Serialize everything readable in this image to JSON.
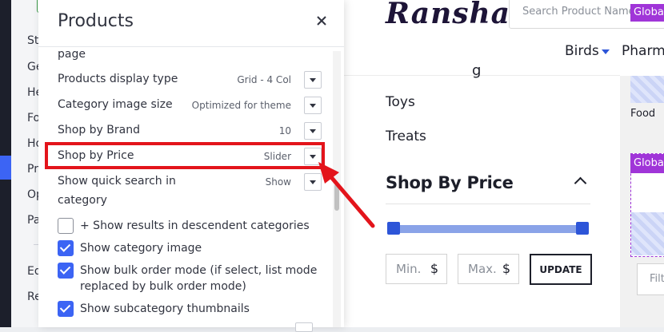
{
  "sidebar": {
    "items": [
      "St",
      "Ge",
      "He",
      "Fo",
      "Ho",
      "Pr",
      "Op",
      "Pa",
      "Ed",
      "Re"
    ]
  },
  "storefront": {
    "logo": "Ransha",
    "search_placeholder": "Search Product Name /",
    "search_tag": "Globa",
    "nav": [
      "Birds",
      "Pharma"
    ],
    "categories": [
      "Toys",
      "Treats"
    ],
    "shop_by_price_title": "Shop By Price",
    "min_placeholder": "Min.",
    "max_placeholder": "Max.",
    "currency": "$",
    "update_label": "UPDATE",
    "food_label": "Food",
    "card_tag": "Globa",
    "filter_placeholder": "Filt"
  },
  "panel": {
    "title": "Products",
    "intro_text": "page",
    "settings": [
      {
        "label": "Products display type",
        "value": "Grid - 4 Col"
      },
      {
        "label": "Category image size",
        "value": "Optimized for theme"
      },
      {
        "label": "Shop by Brand",
        "value": "10"
      },
      {
        "label": "Shop by Price",
        "value": "Slider"
      },
      {
        "label_line1": "Show quick search in",
        "label_line2": "category",
        "value": "Show"
      }
    ],
    "checkboxes": [
      {
        "label": "+ Show results in descendent categories",
        "checked": false
      },
      {
        "label": "Show category image",
        "checked": true
      },
      {
        "label_line1": "Show bulk order mode (if select, list mode",
        "label_line2": "replaced by bulk order mode)",
        "checked": true
      },
      {
        "label": "Show subcategory thumbnails",
        "checked": true
      }
    ]
  },
  "colors": {
    "accent": "#3c64f4",
    "annotation": "#e3141b",
    "tag_purple": "#a035d8",
    "slider": "#2d55d8"
  }
}
